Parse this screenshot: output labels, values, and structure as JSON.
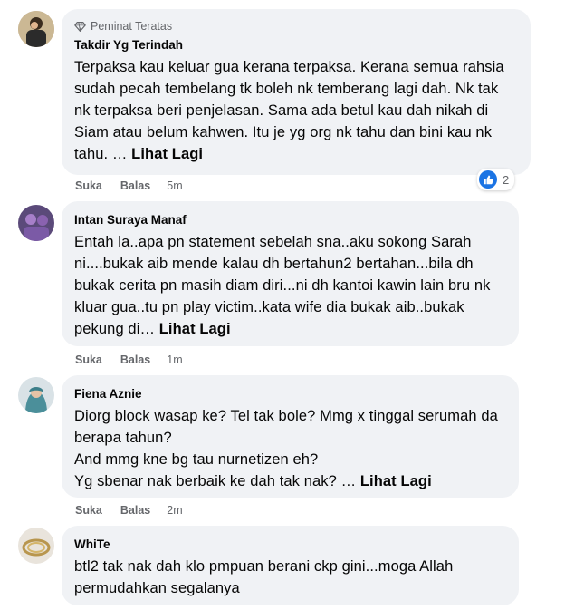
{
  "comments": [
    {
      "badge": "Peminat Teratas",
      "author": "Takdir Yg Terindah",
      "text": "Terpaksa kau keluar gua kerana terpaksa. Kerana semua rahsia sudah pecah tembelang tk boleh nk temberang lagi dah. Nk tak nk terpaksa beri penjelasan. Sama ada betul kau dah nikah di Siam atau belum kahwen. Itu je yg org nk tahu dan bini kau nk tahu. … ",
      "see_more": "Lihat Lagi",
      "like_label": "Suka",
      "reply_label": "Balas",
      "time": "5m",
      "reaction_count": "2",
      "reaction_icon": "like-icon"
    },
    {
      "author": "Intan Suraya Manaf",
      "text": "Entah la..apa pn statement sebelah sna..aku sokong Sarah ni....bukak aib mende kalau dh bertahun2 bertahan...bila dh bukak cerita pn masih diam diri...ni dh kantoi kawin lain bru nk kluar gua..tu pn play victim..kata wife dia bukak aib..bukak pekung di… ",
      "see_more": "Lihat Lagi",
      "like_label": "Suka",
      "reply_label": "Balas",
      "time": "1m"
    },
    {
      "author": "Fiena Aznie",
      "text": "Diorg block wasap ke? Tel tak bole? Mmg x tinggal serumah da berapa tahun?\nAnd mmg kne bg tau nurnetizen eh?\nYg sbenar nak berbaik ke dah tak nak? … ",
      "see_more": "Lihat Lagi",
      "like_label": "Suka",
      "reply_label": "Balas",
      "time": "2m"
    },
    {
      "author": "WhiTe",
      "text": "btl2 tak nak dah klo pmpuan berani ckp gini...moga Allah permudahkan segalanya"
    }
  ],
  "colors": {
    "bubble": "#f0f2f5",
    "secondary_text": "#65676b",
    "like_blue": "#1b74e4"
  }
}
